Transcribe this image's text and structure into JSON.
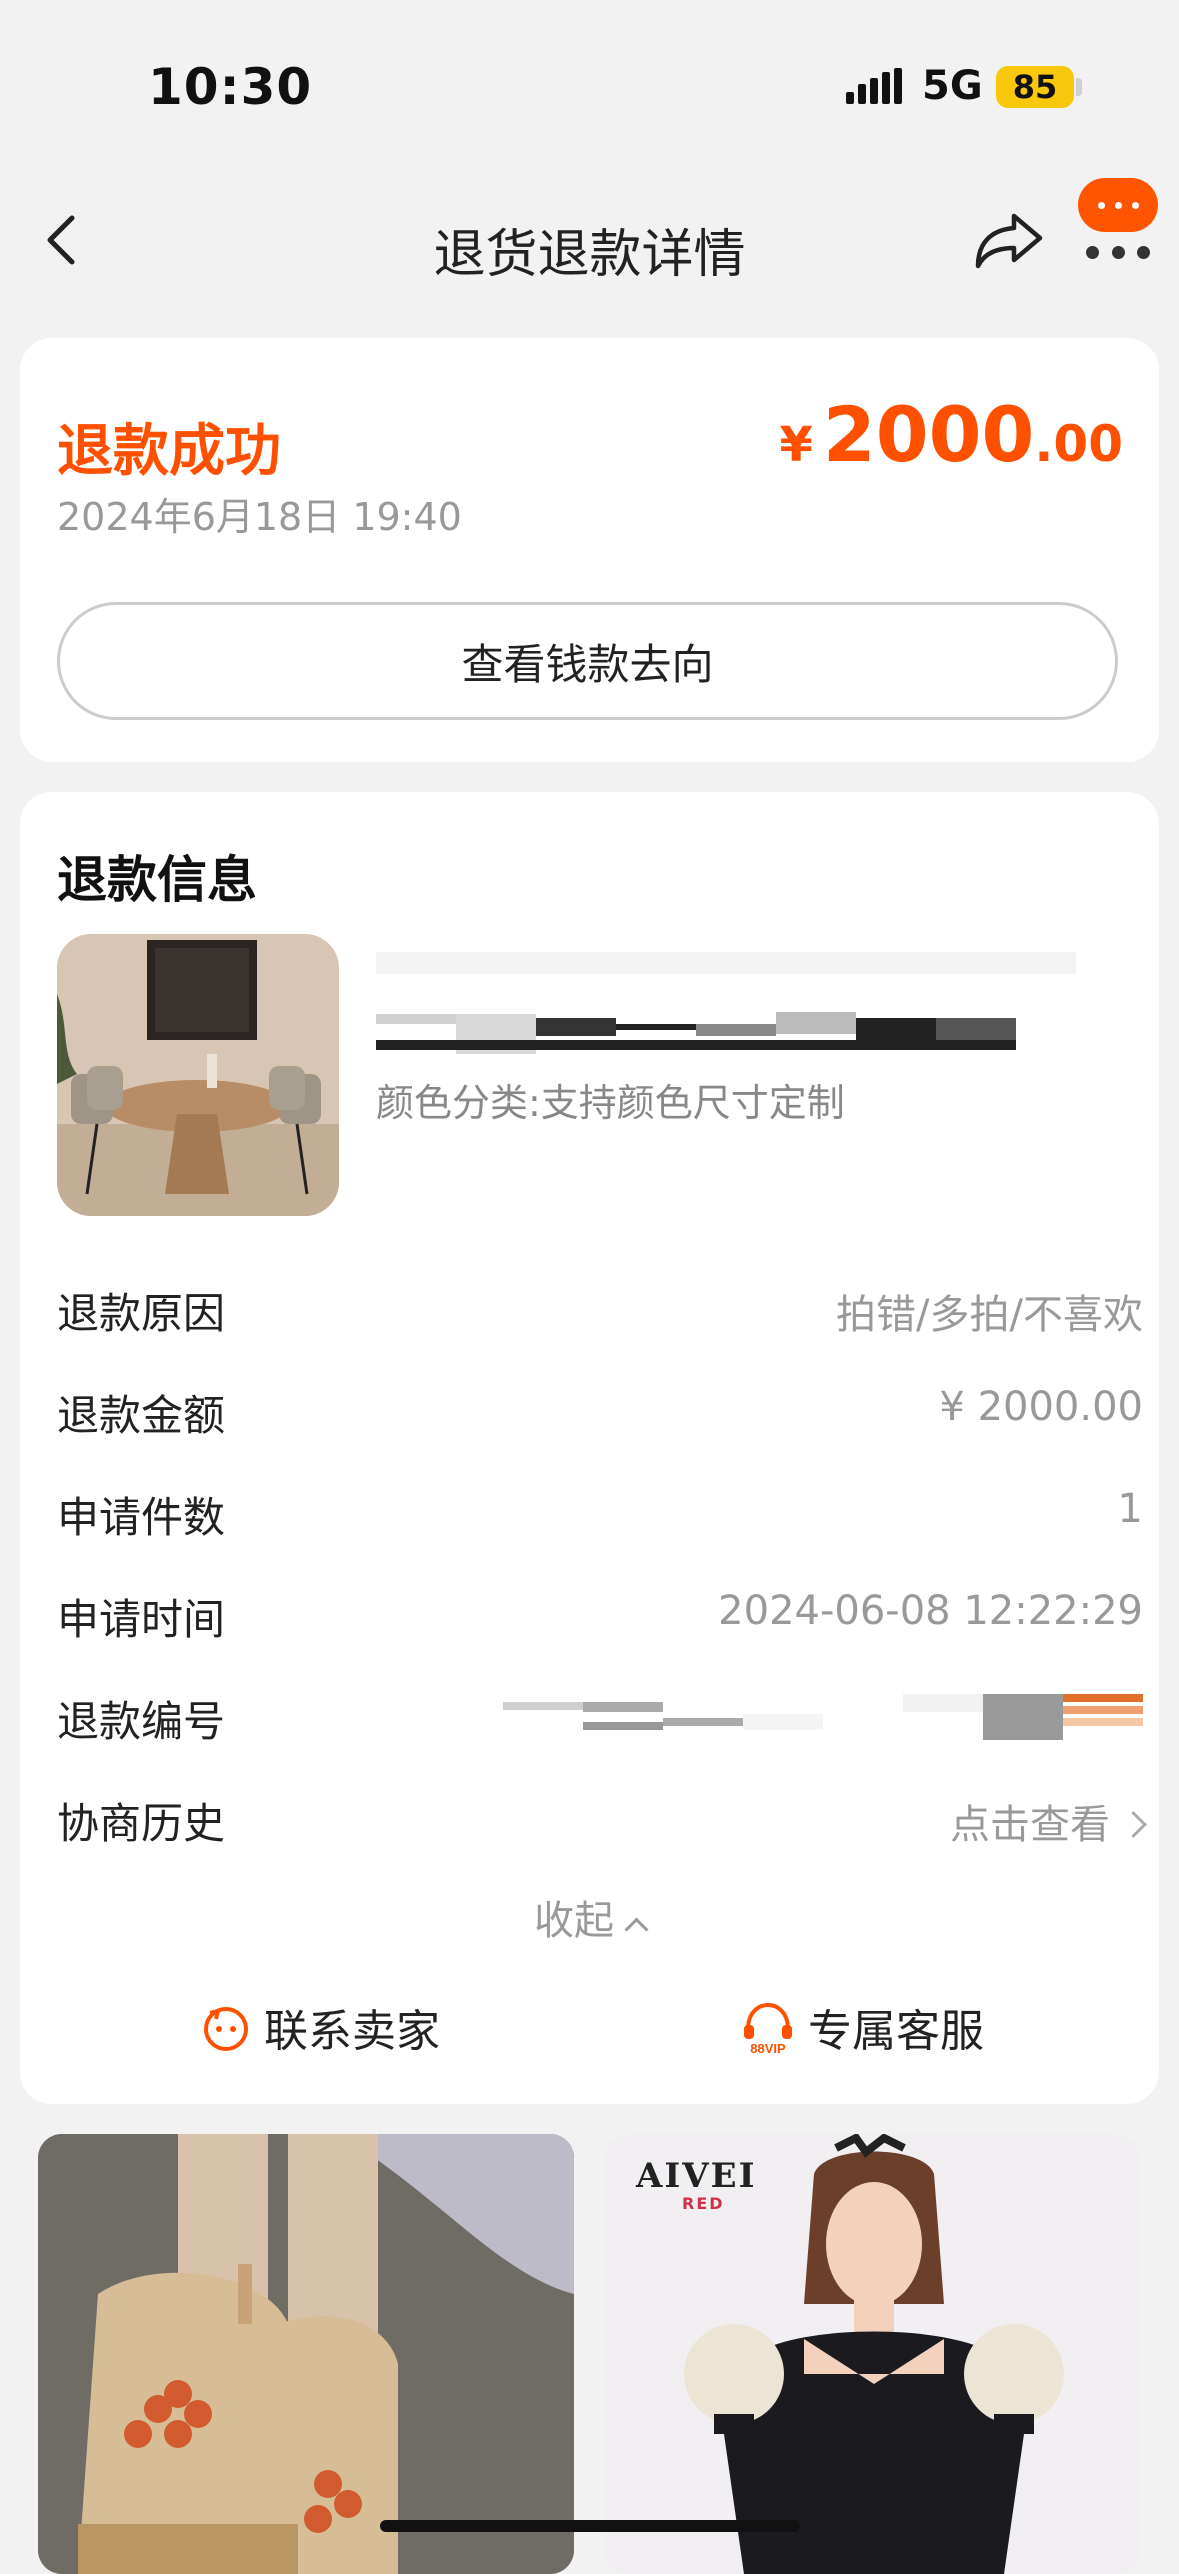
{
  "status_bar": {
    "time": "10:30",
    "network": "5G",
    "battery": "85",
    "battery_color": "#f7c80b"
  },
  "nav": {
    "title": "退货退款详情",
    "back_icon": "chevron-left-icon",
    "share_icon": "share-icon",
    "more_icon": "more-dots-icon",
    "message_badge_color": "#ff5500"
  },
  "refund_status": {
    "title": "退款成功",
    "time": "2024年6月18日 19:40",
    "amount_symbol": "¥",
    "amount_int": "2000",
    "amount_dec": ".00",
    "money_flow_button": "查看钱款去向",
    "accent_color": "#ff5000"
  },
  "refund_info": {
    "section_title": "退款信息",
    "product_spec": "颜色分类:支持颜色尺寸定制",
    "rows": [
      {
        "label": "退款原因",
        "value": "拍错/多拍/不喜欢"
      },
      {
        "label": "退款金额",
        "value": "¥ 2000.00"
      },
      {
        "label": "申请件数",
        "value": "1"
      },
      {
        "label": "申请时间",
        "value": "2024-06-08 12:22:29"
      },
      {
        "label": "退款编号",
        "value": ""
      },
      {
        "label": "协商历史",
        "value": "点击查看"
      }
    ],
    "collapse_label": "收起",
    "contact_seller": "联系卖家",
    "exclusive_service": "专属客服",
    "vip_badge": "88VIP"
  },
  "recommendations": {
    "brand_logo": "AIVEI",
    "brand_sub": "RED"
  }
}
